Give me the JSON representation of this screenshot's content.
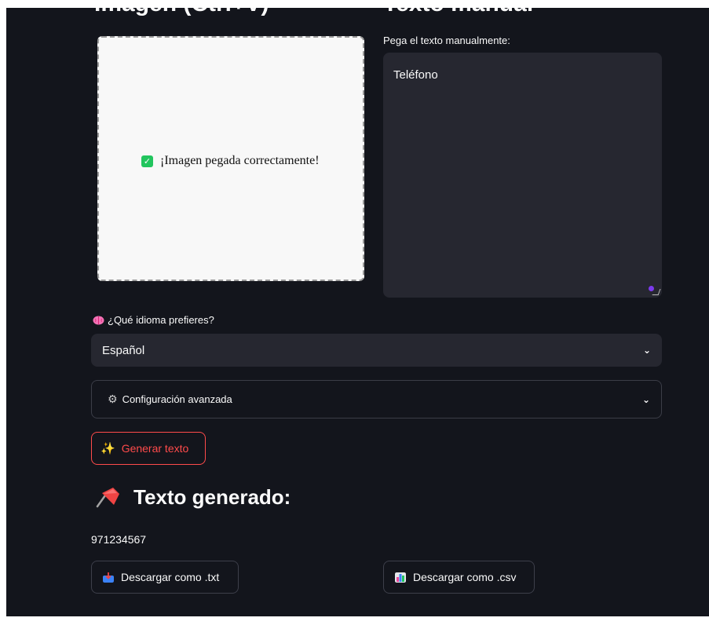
{
  "columns": {
    "left_title": "Imagen (Ctrl+V)",
    "right_title": "Texto manual"
  },
  "paste_area": {
    "success_message": "¡Imagen pegada correctamente!"
  },
  "manual_text": {
    "label": "Pega el texto manualmente:",
    "value": "Teléfono"
  },
  "language": {
    "label": "¿Qué idioma prefieres?",
    "selected": "Español"
  },
  "advanced": {
    "label": "Configuración avanzada"
  },
  "generate_button": {
    "label": "Generar texto"
  },
  "output": {
    "title": "Texto generado:",
    "value": "971234567"
  },
  "downloads": {
    "txt_label": "Descargar como .txt",
    "csv_label": "Descargar como .csv"
  },
  "icons": {
    "success": "check-icon",
    "language": "brain-icon",
    "advanced": "gear-icon",
    "generate": "sparkles-icon",
    "title": "pushpin-icon",
    "txt": "inbox-tray-icon",
    "csv": "bar-chart-icon"
  },
  "colors": {
    "accent_red": "#ff4b4b",
    "success_green": "#22c55e",
    "background": "#13151c",
    "input_bg": "#262730"
  }
}
